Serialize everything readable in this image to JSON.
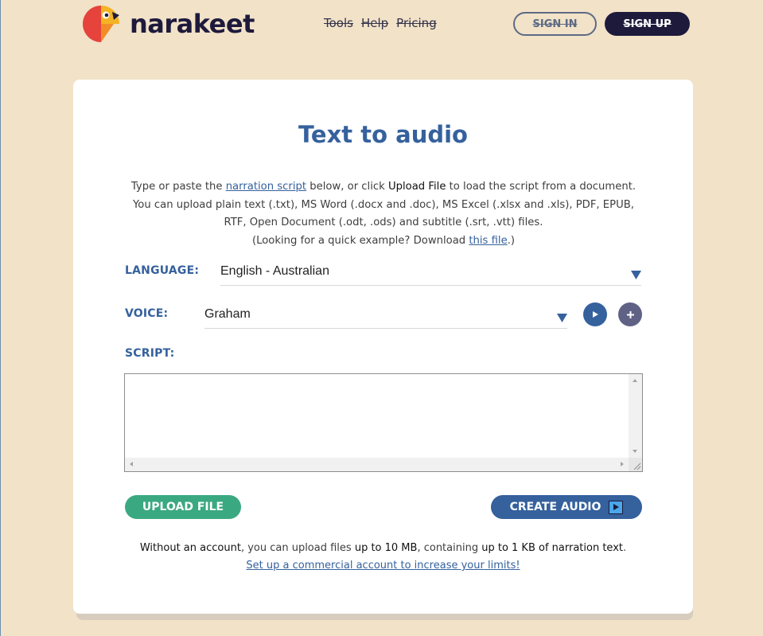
{
  "header": {
    "brand": "narakeet",
    "nav": [
      "Tools",
      "Help",
      "Pricing"
    ],
    "sign_in": "SIGN IN",
    "sign_up": "SIGN UP"
  },
  "main": {
    "title": "Text to audio",
    "intro": {
      "p1_before": "Type or paste the ",
      "link_script": "narration script",
      "p1_mid": " below, or click ",
      "upload_file_strong": "Upload File",
      "p1_after": " to load the script from a document. You can upload plain text (.txt), MS Word (.docx and .doc), MS Excel (.xlsx and .xls), PDF, EPUB, RTF, Open Document (.odt, .ods) and subtitle (.srt, .vtt) files.",
      "p2_before": "(Looking for a quick example? Download ",
      "link_file": "this file",
      "p2_after": ".)"
    },
    "language_label": "LANGUAGE:",
    "language_value": "English - Australian",
    "voice_label": "VOICE:",
    "voice_value": "Graham",
    "script_label": "SCRIPT:",
    "script_value": "",
    "upload_button": "UPLOAD FILE",
    "create_button": "CREATE AUDIO",
    "limits_strong_before": "Without an account",
    "limits_mid": ", you can upload files ",
    "limits_strong_size": "up to 10 MB",
    "limits_mid2": ", containing ",
    "limits_strong_text": "up to 1 KB of narration text",
    "limits_end": ".",
    "limits_link": "Set up a commercial account to increase your limits!"
  },
  "colors": {
    "background": "#f1e2c8",
    "brand_dark": "#1e1a3c",
    "primary_blue": "#35619d",
    "upload_green": "#3aa981"
  },
  "icons": [
    "parrot-logo-icon",
    "chevron-down-icon",
    "play-icon",
    "plus-icon"
  ]
}
